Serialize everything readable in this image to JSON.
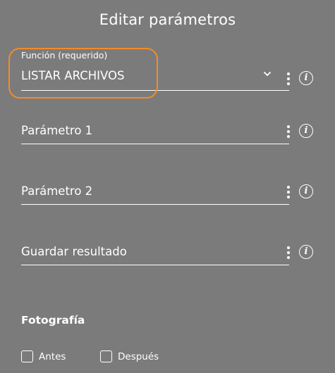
{
  "dialog": {
    "title": "Editar parámetros"
  },
  "fields": {
    "funcion": {
      "label": "Función (requerido)",
      "value": "LISTAR ARCHIVOS"
    },
    "parametro1": {
      "placeholder": "Parámetro 1"
    },
    "parametro2": {
      "placeholder": "Parámetro 2"
    },
    "guardar": {
      "placeholder": "Guardar resultado"
    }
  },
  "fotografia": {
    "title": "Fotografía",
    "antes_label": "Antes",
    "despues_label": "Después"
  },
  "icons": {
    "info_glyph": "i",
    "chevron": "chevron-down-icon",
    "menu": "more-vert-icon",
    "info": "info-icon"
  },
  "colors": {
    "background": "#7b7b7b",
    "text": "#ffffff",
    "highlight": "#f28c28"
  }
}
